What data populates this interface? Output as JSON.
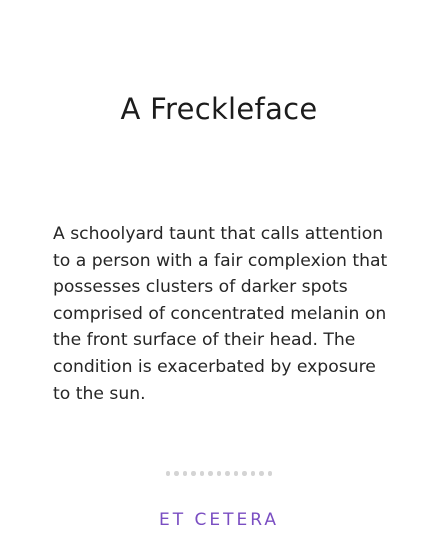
{
  "card": {
    "title": "A Freckleface",
    "definition": "A schoolyard taunt that calls attention to a person with a fair complexion that possesses clusters of darker spots comprised of concentrated melanin on the front surface of their head. The condition is exacerbated by exposure to the sun.",
    "brand": "ET CETERA"
  },
  "pagination": {
    "dot_count": 13
  },
  "colors": {
    "brand": "#7a4ec2",
    "dot": "#d4d4d4",
    "text": "#1c1c1c"
  }
}
